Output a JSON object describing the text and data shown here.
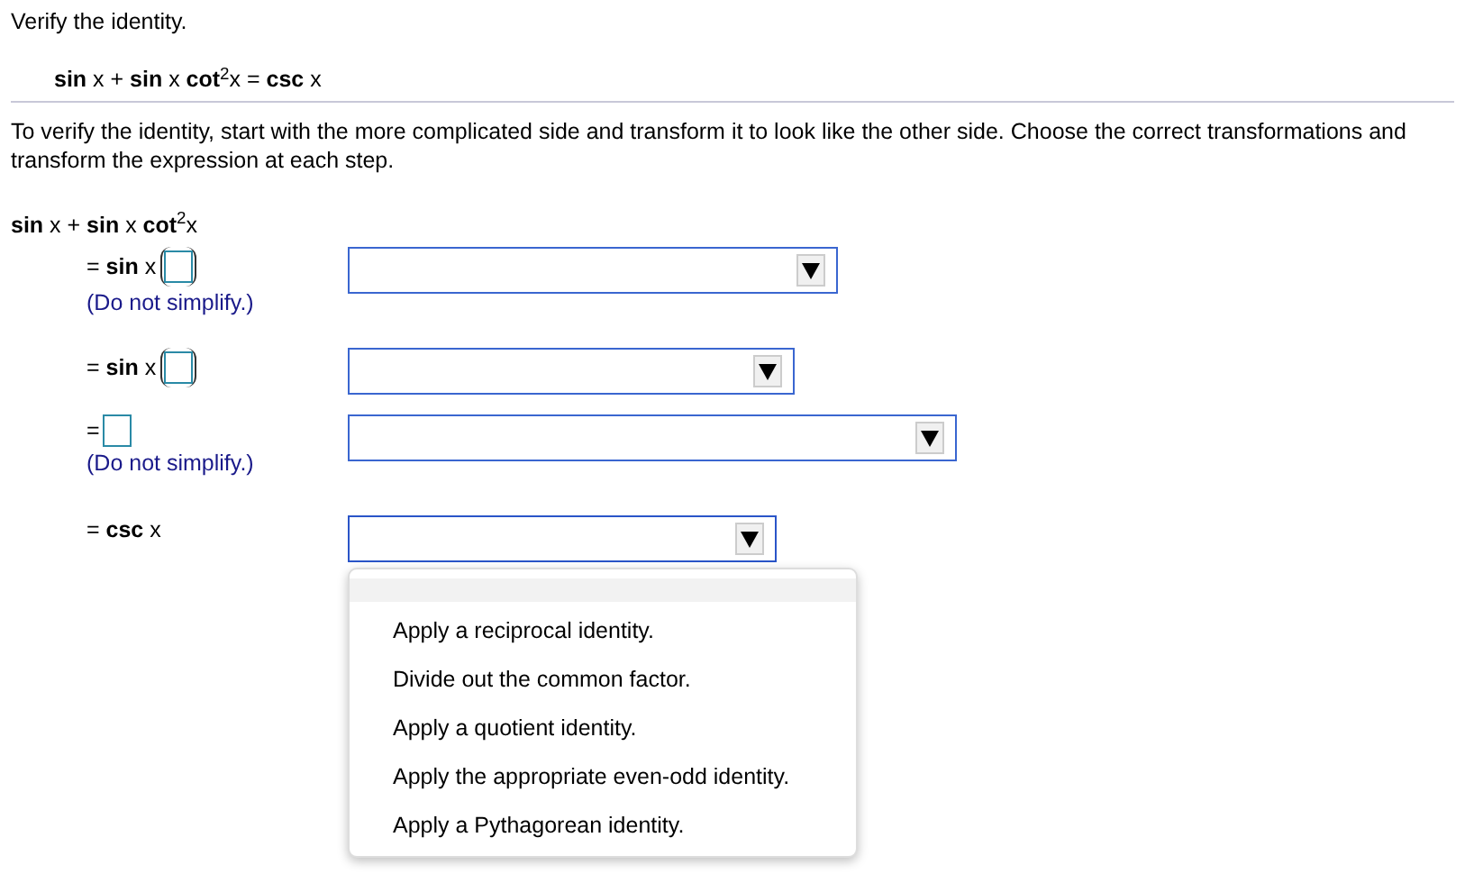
{
  "title": "Verify the identity.",
  "identity": "**sin** x + **sin** x **cot**$^{2}$x = **csc** x",
  "instructions": "To verify the identity, start with the more complicated side and transform it to look like the other side. Choose the correct transformations and transform the expression at each step.",
  "start_expression": "**sin** x + **sin** x **cot**$^{2}$x",
  "steps": [
    {
      "expression": "= **sin** x",
      "answer_box": true,
      "parenthesized": true,
      "note": "(Do not simplify.)",
      "dropdown": {
        "expanded": false
      }
    },
    {
      "expression": "= **sin** x",
      "answer_box": true,
      "parenthesized": true,
      "dropdown": {
        "expanded": false
      }
    },
    {
      "expression": "=",
      "answer_box": true,
      "parenthesized": false,
      "note": "(Do not simplify.)",
      "dropdown": {
        "expanded": false
      }
    },
    {
      "expression": "= **csc** x",
      "answer_box": false,
      "dropdown": {
        "expanded": true,
        "options": [
          {
            "label": "Apply a reciprocal identity.",
            "selected": false
          },
          {
            "label": "Divide out the common factor.",
            "selected": false
          },
          {
            "label": "Apply a quotient identity.",
            "selected": false
          },
          {
            "label": "Apply the appropriate even-odd identity.",
            "selected": false
          },
          {
            "label": "Apply a Pythagorean identity.",
            "selected": false
          }
        ]
      }
    }
  ]
}
